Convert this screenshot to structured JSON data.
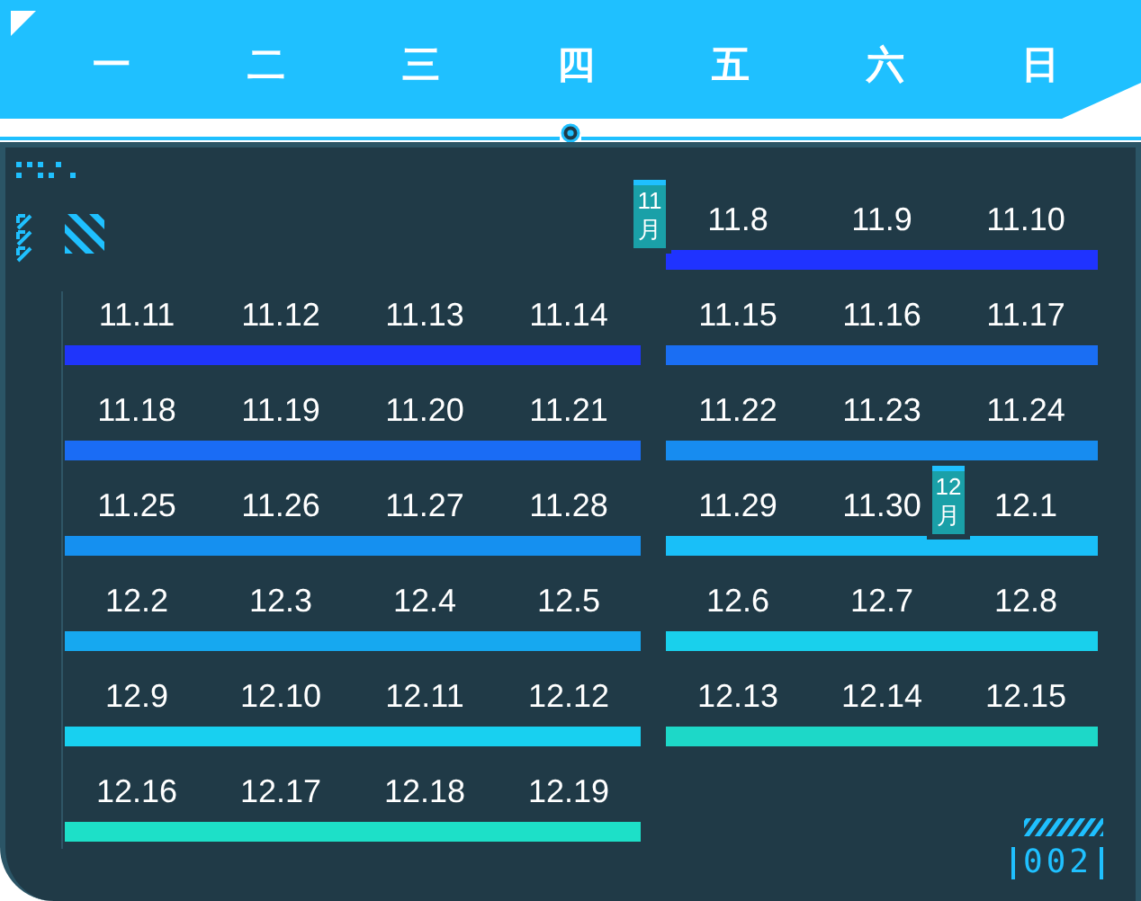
{
  "weekdays": [
    {
      "label": "一"
    },
    {
      "label": "二"
    },
    {
      "label": "三"
    },
    {
      "label": "四"
    },
    {
      "label": "五"
    },
    {
      "label": "六"
    },
    {
      "label": "日"
    }
  ],
  "weeks": [
    {
      "segments": [
        {
          "kind": "weekend",
          "color": "#1f33ff",
          "days": [
            {
              "label": "11.8",
              "month_tag": "11月"
            },
            {
              "label": "11.9"
            },
            {
              "label": "11.10"
            }
          ]
        }
      ]
    },
    {
      "segments": [
        {
          "kind": "weekday",
          "color": "#1f35fb",
          "days": [
            {
              "label": "11.11"
            },
            {
              "label": "11.12"
            },
            {
              "label": "11.13"
            },
            {
              "label": "11.14"
            }
          ]
        },
        {
          "kind": "weekend",
          "color": "#1a6ef3",
          "days": [
            {
              "label": "11.15"
            },
            {
              "label": "11.16"
            },
            {
              "label": "11.17"
            }
          ]
        }
      ]
    },
    {
      "segments": [
        {
          "kind": "weekday",
          "color": "#1a6cf5",
          "days": [
            {
              "label": "11.18"
            },
            {
              "label": "11.19"
            },
            {
              "label": "11.20"
            },
            {
              "label": "11.21"
            }
          ]
        },
        {
          "kind": "weekend",
          "color": "#178cf0",
          "days": [
            {
              "label": "11.22"
            },
            {
              "label": "11.23"
            },
            {
              "label": "11.24"
            }
          ]
        }
      ]
    },
    {
      "segments": [
        {
          "kind": "weekday",
          "color": "#1590f0",
          "days": [
            {
              "label": "11.25"
            },
            {
              "label": "11.26"
            },
            {
              "label": "11.27"
            },
            {
              "label": "11.28"
            }
          ]
        },
        {
          "kind": "weekend",
          "color": "#19bff8",
          "days": [
            {
              "label": "11.29"
            },
            {
              "label": "11.30"
            },
            {
              "label": "12.1",
              "month_tag": "12月"
            }
          ]
        }
      ]
    },
    {
      "segments": [
        {
          "kind": "weekday",
          "color": "#16a8f0",
          "days": [
            {
              "label": "12.2"
            },
            {
              "label": "12.3"
            },
            {
              "label": "12.4"
            },
            {
              "label": "12.5"
            }
          ]
        },
        {
          "kind": "weekend",
          "color": "#19d0ec",
          "days": [
            {
              "label": "12.6"
            },
            {
              "label": "12.7"
            },
            {
              "label": "12.8"
            }
          ]
        }
      ]
    },
    {
      "segments": [
        {
          "kind": "weekday",
          "color": "#18d0f0",
          "days": [
            {
              "label": "12.9"
            },
            {
              "label": "12.10"
            },
            {
              "label": "12.11"
            },
            {
              "label": "12.12"
            }
          ]
        },
        {
          "kind": "weekend",
          "color": "#1dd8c8",
          "days": [
            {
              "label": "12.13"
            },
            {
              "label": "12.14"
            },
            {
              "label": "12.15"
            }
          ]
        }
      ]
    },
    {
      "segments": [
        {
          "kind": "weekday",
          "color": "#1de0c8",
          "days": [
            {
              "label": "12.16"
            },
            {
              "label": "12.17"
            },
            {
              "label": "12.18"
            },
            {
              "label": "12.19"
            }
          ]
        }
      ]
    }
  ],
  "badge": {
    "label": "002"
  }
}
